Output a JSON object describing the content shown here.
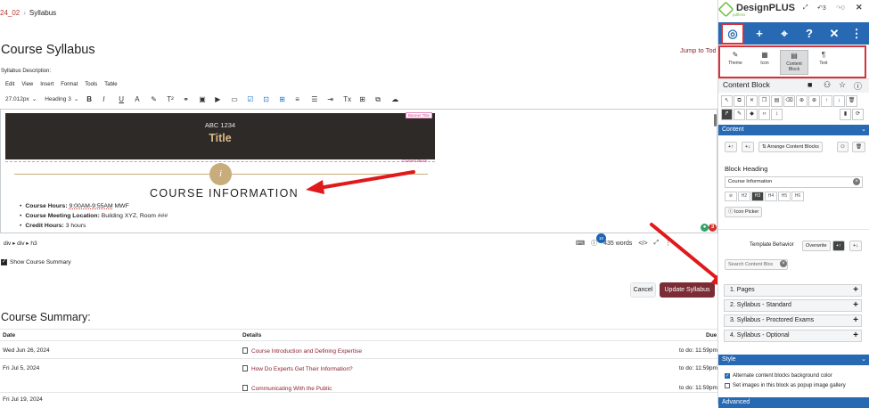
{
  "breadcrumb": {
    "course": "24_02",
    "page": "Syllabus"
  },
  "page": {
    "title": "Course Syllabus",
    "jump_link": "Jump to Today",
    "syllabus_label": "Syllabus Description:"
  },
  "editor": {
    "menu": [
      "Edit",
      "View",
      "Insert",
      "Format",
      "Tools",
      "Table"
    ],
    "font_size": "27.012px",
    "block_format": "Heading 3",
    "banner_code": "ABC 1234",
    "banner_title": "Title",
    "banner_tag": "Banner Title",
    "content_block_tag": "Content Block",
    "info_icon": "i",
    "course_info_heading": "COURSE INFORMATION",
    "items": [
      {
        "label": "Course Hours:",
        "value": "9:00AM-9:55AM",
        "suffix": " MWF"
      },
      {
        "label": "Course Meeting Location:",
        "value": "Building XYZ, Room ###",
        "suffix": ""
      },
      {
        "label": "Credit Hours:",
        "value": "3 hours",
        "suffix": ""
      }
    ],
    "path": "div ▸ div ▸ h3",
    "word_count": "435 words",
    "badge": "10",
    "code_toggle": "</>",
    "pin_count": "3"
  },
  "show_summary_label": "Show Course Summary",
  "buttons": {
    "cancel": "Cancel",
    "update": "Update Syllabus"
  },
  "summary": {
    "title": "Course Summary:",
    "columns": [
      "Date",
      "Details",
      "Due"
    ],
    "rows": [
      {
        "date": "Wed Jun 26, 2024",
        "detail": "Course Introduction and Defining Expertise",
        "due": "to do: 11:59pm"
      },
      {
        "date": "Fri Jul 5, 2024",
        "detail": "How Do Experts Get Their Information?",
        "due": "to do: 11:59pm"
      },
      {
        "date": "",
        "detail": "Communicating With the Public",
        "due": "to do: 11:59pm"
      },
      {
        "date": "Fri Jul 19, 2024",
        "detail": "",
        "due": ""
      }
    ]
  },
  "sidebar": {
    "brand": "DesignPLUS",
    "brand_sub": "pdfless",
    "undo_count": "3",
    "redo_count": "0",
    "tiles": [
      {
        "icon": "✎",
        "label": "Theme"
      },
      {
        "icon": "▦",
        "label": "Icon"
      },
      {
        "icon": "▤",
        "label": "Content Block"
      },
      {
        "icon": "¶",
        "label": "Text"
      }
    ],
    "panel_title": "Content Block",
    "content_section": "Content",
    "arrange_label": "Arrange Content Blocks",
    "block_heading_label": "Block Heading",
    "block_heading_value": "Course Information",
    "heading_levels": [
      "H2",
      "H3",
      "H4",
      "H5",
      "H6"
    ],
    "icon_picker": "Icon Picker",
    "template_behavior": "Template Behavior",
    "overwrite": "Overwrite",
    "search_placeholder": "Search Content Bloc",
    "templates": [
      "1. Pages",
      "2. Syllabus - Standard",
      "3. Syllabus - Proctored Exams",
      "4. Syllabus - Optional"
    ],
    "style_section": "Style",
    "opt_alternate": "Alternate content blocks background color",
    "opt_gallery": "Set images in this block as popup image gallery",
    "advanced_section": "Advanced"
  }
}
